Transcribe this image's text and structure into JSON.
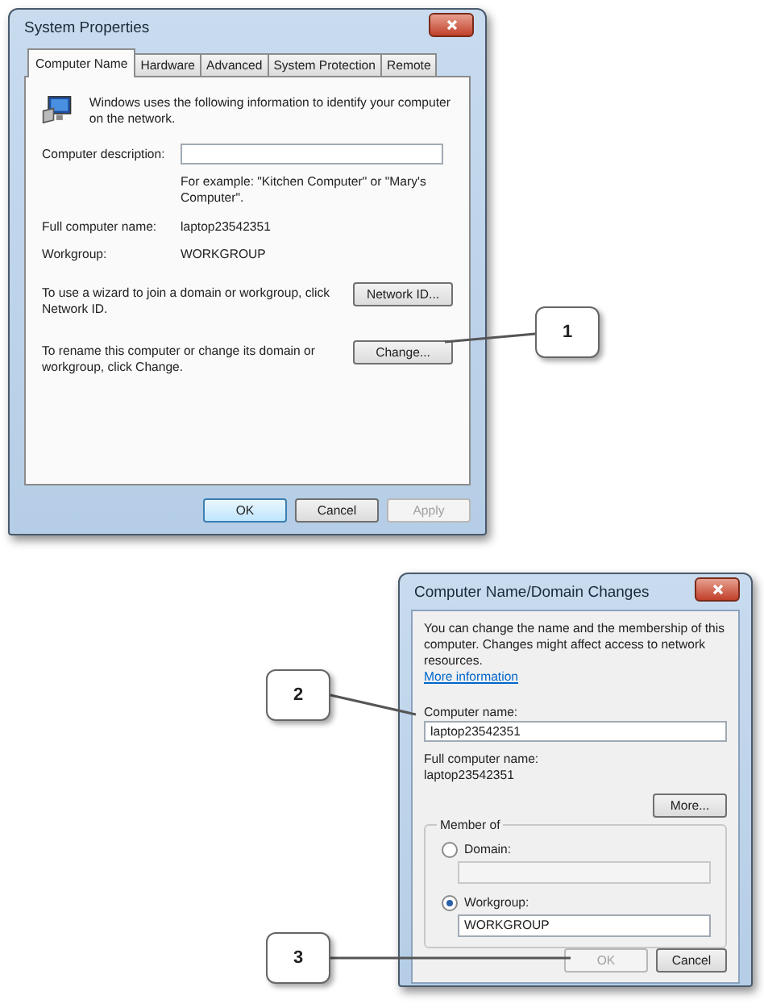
{
  "system_properties": {
    "title": "System Properties",
    "tabs": [
      {
        "label": "Computer Name",
        "selected": true
      },
      {
        "label": "Hardware",
        "selected": false
      },
      {
        "label": "Advanced",
        "selected": false
      },
      {
        "label": "System Protection",
        "selected": false
      },
      {
        "label": "Remote",
        "selected": false
      }
    ],
    "intro": "Windows uses the following information to identify your computer on the network.",
    "description_label": "Computer description:",
    "example": "For example: \"Kitchen Computer\" or \"Mary's Computer\".",
    "info": [
      {
        "label": "Full computer name:",
        "value": "laptop23542351"
      },
      {
        "label": "Workgroup:",
        "value": "WORKGROUP"
      }
    ],
    "actions": [
      {
        "text": "To use a wizard to join a domain or workgroup, click Network ID.",
        "button": "Network ID..."
      },
      {
        "text": "To rename this computer or change its domain or workgroup, click Change.",
        "button": "Change..."
      }
    ],
    "buttons": [
      {
        "label": "OK",
        "disabled": false,
        "default": true
      },
      {
        "label": "Cancel",
        "disabled": false,
        "default": false
      },
      {
        "label": "Apply",
        "disabled": true,
        "default": false
      }
    ]
  },
  "domain_changes": {
    "title": "Computer Name/Domain Changes",
    "intro": "You can change the name and the membership of this computer. Changes might affect access to network resources.",
    "link": "More information",
    "name_label": "Computer name:",
    "name_value": "laptop23542351",
    "full_label": "Full computer name:",
    "full_value": "laptop23542351",
    "more_button": "More...",
    "member_of": {
      "label": "Member of",
      "options": [
        {
          "label": "Domain:",
          "selected": false
        },
        {
          "label": "Workgroup:",
          "selected": true,
          "value": "WORKGROUP"
        }
      ]
    },
    "buttons": [
      {
        "label": "OK",
        "disabled": true
      },
      {
        "label": "Cancel",
        "disabled": false
      }
    ]
  },
  "callouts": [
    {
      "label": "1"
    },
    {
      "label": "2"
    },
    {
      "label": "3"
    }
  ]
}
